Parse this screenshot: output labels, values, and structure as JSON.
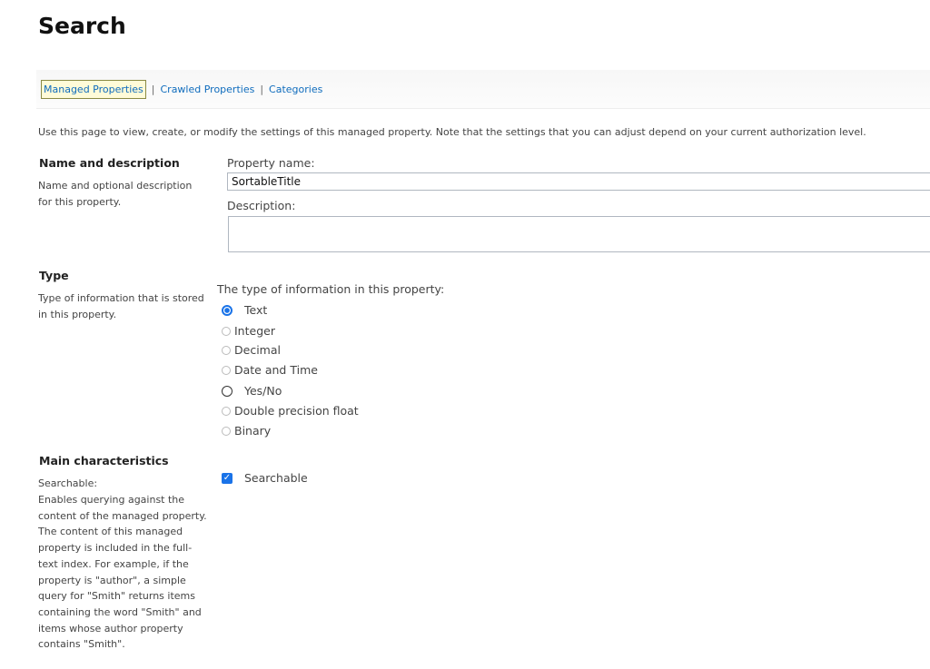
{
  "page_title": "Search",
  "subnav": {
    "items": [
      "Managed Properties",
      "Crawled Properties",
      "Categories"
    ],
    "separator": "|"
  },
  "intro": "Use this page to view, create, or modify the settings of this managed property. Note that the settings that you can adjust depend on your current authorization level.",
  "name_section": {
    "title": "Name and description",
    "description": "Name and optional description for this property.",
    "property_name_label": "Property name:",
    "property_name_value": "SortableTitle",
    "description_label": "Description:",
    "description_value": ""
  },
  "type_section": {
    "title": "Type",
    "description": "Type of information that is stored in this property.",
    "prompt": "The type of information in this property:",
    "options": [
      "Text",
      "Integer",
      "Decimal",
      "Date and Time",
      "Yes/No",
      "Double precision float",
      "Binary"
    ],
    "selected": "Text"
  },
  "main_section": {
    "title": "Main characteristics",
    "searchable_heading": "Searchable:",
    "searchable_description": "Enables querying against the content of the managed property. The content of this managed property is included in the full-text index. For example, if the property is \"author\", a simple query for \"Smith\" returns items containing the word \"Smith\" and items whose author property contains \"Smith\".",
    "searchable_label": "Searchable",
    "searchable_checked": true
  },
  "colors": {
    "link": "#0f6cbd",
    "accent": "#1a73e8",
    "active_tab_background": "#fffbd8"
  }
}
